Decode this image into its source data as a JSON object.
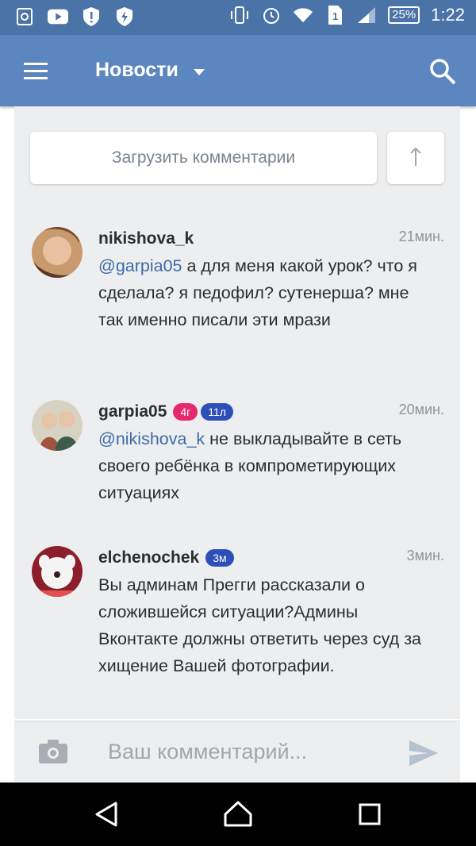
{
  "status_bar": {
    "time": "1:22",
    "battery": "25%",
    "sim_slot": "1",
    "icons_left": [
      "chrome-icon",
      "youtube-icon",
      "alert-shield-icon",
      "bolt-shield-icon"
    ],
    "icons_right": [
      "vibrate-icon",
      "alarm-icon",
      "wifi-icon",
      "sim-icon",
      "signal-icon",
      "battery-icon"
    ]
  },
  "appbar": {
    "title": "Новости",
    "menu_icon": "menu-icon",
    "dropdown_icon": "caret-down-icon",
    "search_icon": "search-icon"
  },
  "load_comments": {
    "label": "Загрузить комментарии",
    "up_icon": "arrow-up-icon"
  },
  "comments": [
    {
      "author": "nikishova_k",
      "time": "21мин.",
      "mention": "@garpia05",
      "text": " а для меня какой урок? что я сделала? я педофил? сутенерша? мне так именно писали эти мрази",
      "badges": []
    },
    {
      "author": "garpia05",
      "time": "20мин.",
      "mention": "@nikishova_k",
      "text": " не выкладывайте в сеть своего ребёнка в компрометирующих ситуациях",
      "badges": [
        {
          "label": "4г",
          "color": "#e6286e"
        },
        {
          "label": "11л",
          "color": "#2f4fb8"
        }
      ]
    },
    {
      "author": "elchenochek",
      "time": "3мин.",
      "mention": "",
      "text": "Вы админам Прегги рассказали о сложившейся ситуации?Админы Вконтакте должны ответить через суд за хищение Вашей фотографии.",
      "badges": [
        {
          "label": "3м",
          "color": "#2f4fb8"
        }
      ]
    }
  ],
  "composer": {
    "placeholder": "Ваш комментарий...",
    "camera_icon": "camera-icon",
    "send_icon": "send-icon"
  },
  "nav_bar": {
    "icons": [
      "back-icon",
      "home-icon",
      "recents-icon"
    ]
  },
  "colors": {
    "status_bar": "#4a73a8",
    "app_bar": "#5b86c0",
    "background": "#edeef0",
    "mention": "#3d6ba8"
  }
}
